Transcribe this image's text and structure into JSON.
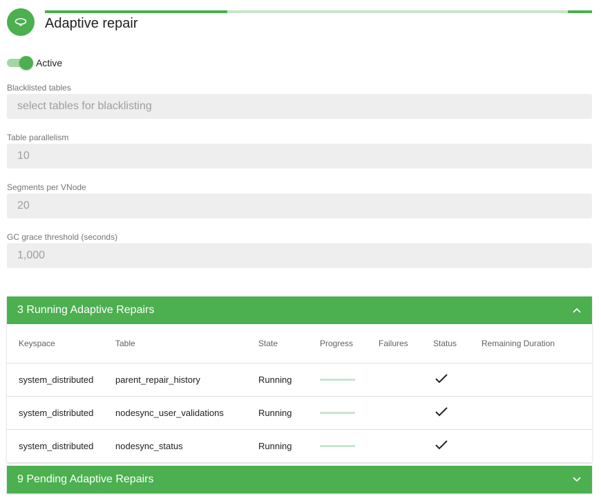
{
  "header": {
    "title": "Adaptive repair",
    "icon": "repair-loop-icon",
    "accent_color": "#4caf50"
  },
  "toggle": {
    "label": "Active",
    "state": "on"
  },
  "fields": {
    "blacklisted": {
      "label": "Blacklisted tables",
      "placeholder": "select tables for blacklisting",
      "value": ""
    },
    "parallelism": {
      "label": "Table parallelism",
      "value": "10"
    },
    "segments": {
      "label": "Segments per VNode",
      "value": "20"
    },
    "gc_grace": {
      "label": "GC grace threshold (seconds)",
      "value": "1,000"
    }
  },
  "running_panel": {
    "title": "3 Running Adaptive Repairs",
    "icon": "chevron-up-icon",
    "columns": [
      "Keyspace",
      "Table",
      "State",
      "Progress",
      "Failures",
      "Status",
      "Remaining Duration"
    ],
    "rows": [
      {
        "keyspace": "system_distributed",
        "table": "parent_repair_history",
        "state": "Running",
        "progress": 0,
        "failures": "",
        "status": "check-icon",
        "remaining": ""
      },
      {
        "keyspace": "system_distributed",
        "table": "nodesync_user_validations",
        "state": "Running",
        "progress": 0,
        "failures": "",
        "status": "check-icon",
        "remaining": ""
      },
      {
        "keyspace": "system_distributed",
        "table": "nodesync_status",
        "state": "Running",
        "progress": 0,
        "failures": "",
        "status": "check-icon",
        "remaining": ""
      }
    ]
  },
  "pending_panel": {
    "title": "9 Pending Adaptive Repairs",
    "icon": "chevron-down-icon"
  }
}
